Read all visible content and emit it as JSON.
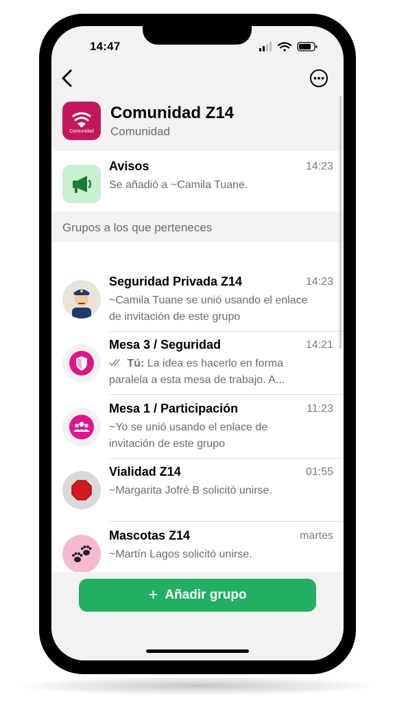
{
  "status_bar": {
    "time": "14:47"
  },
  "community": {
    "name": "Comunidad Z14",
    "subtitle": "Comunidad",
    "logo_text": "Comunidad",
    "accent": "#c2185b"
  },
  "announcements": {
    "title": "Avisos",
    "time": "14:23",
    "message": "Se añadió a ~Camila Tuane.",
    "icon": "megaphone-icon"
  },
  "section_header": "Grupos a los que perteneces",
  "groups": [
    {
      "title": "Seguridad Privada Z14",
      "time": "14:23",
      "message": "~Camila Tuane se unió usando el enlace de invitación de este grupo",
      "icon": "police-officer-icon"
    },
    {
      "title": "Mesa 3 / Seguridad",
      "time": "14:21",
      "you_label": "Tú:",
      "message": "La idea es hacerlo en forma paralela a esta mesa de trabajo. A...",
      "icon": "shield-icon"
    },
    {
      "title": "Mesa 1 / Participación",
      "time": "11:23",
      "message": "~Yo se unió usando el enlace de invitación de este grupo",
      "icon": "people-icon"
    },
    {
      "title": "Vialidad Z14",
      "time": "01:55",
      "message": "~Margarita Jofré B solicitó unirse.",
      "icon": "stop-sign-icon"
    },
    {
      "title": "Mascotas Z14",
      "time": "martes",
      "message": "~Martín Lagos solicitó unirse.",
      "icon": "paw-prints-icon"
    }
  ],
  "add_button": {
    "icon": "+",
    "label": "Añadir grupo",
    "color": "#22ae63"
  }
}
